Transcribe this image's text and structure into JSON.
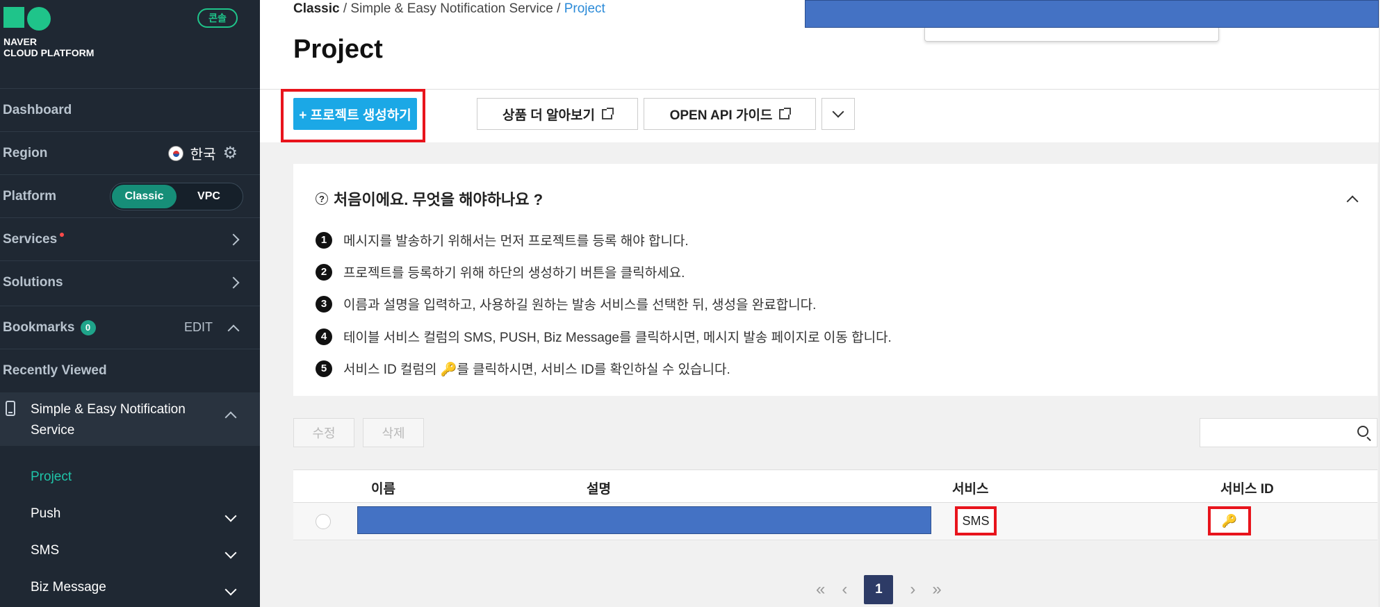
{
  "sidebar": {
    "logo_text_line1": "NAVER",
    "logo_text_line2": "CLOUD PLATFORM",
    "console_badge": "콘솔",
    "dashboard": "Dashboard",
    "region_label": "Region",
    "region_value": "한국",
    "platform_label": "Platform",
    "platform_options": [
      "Classic",
      "VPC"
    ],
    "services_label": "Services",
    "solutions_label": "Solutions",
    "bookmarks_label": "Bookmarks",
    "bookmarks_count": "0",
    "bookmarks_edit": "EDIT",
    "recently_viewed": "Recently Viewed",
    "service_title": "Simple & Easy Notification Service",
    "service_items": [
      "Project",
      "Push",
      "SMS",
      "Biz Message"
    ]
  },
  "breadcrumb": {
    "root": "Classic",
    "service": "Simple & Easy Notification Service",
    "current": "Project",
    "sep": "/"
  },
  "page_title": "Project",
  "toolbar": {
    "create_label": "+ 프로젝트 생성하기",
    "learn_more_label": "상품 더 알아보기",
    "api_guide_label": "OPEN API 가이드"
  },
  "guide": {
    "title": "처음이에요. 무엇을 해야하나요 ?",
    "steps": [
      {
        "num": "1",
        "text": "메시지를 발송하기 위해서는 먼저 프로젝트를 등록 해야 합니다."
      },
      {
        "num": "2",
        "text": "프로젝트를 등록하기 위해 하단의 생성하기 버튼을 클릭하세요."
      },
      {
        "num": "3",
        "text": "이름과 설명을 입력하고, 사용하길 원하는 발송 서비스를 선택한 뒤, 생성을 완료합니다."
      },
      {
        "num": "4",
        "text": "테이블 서비스 컬럼의 SMS, PUSH, Biz Message를 클릭하시면, 메시지 발송 페이지로 이동 합니다."
      },
      {
        "num": "5",
        "text_before": "서비스 ID 컬럼의 ",
        "text_after": "를 클릭하시면, 서비스 ID를 확인하실 수 있습니다."
      }
    ]
  },
  "actions": {
    "edit": "수정",
    "delete": "삭제"
  },
  "table": {
    "headers": {
      "name": "이름",
      "description": "설명",
      "service": "서비스",
      "service_id": "서비스 ID"
    },
    "rows": [
      {
        "service": "SMS"
      }
    ]
  },
  "pagination": {
    "current": "1",
    "first": "«",
    "prev": "‹",
    "next": "›",
    "last": "»"
  },
  "colors": {
    "accent": "#1ba8e6",
    "sidebar_bg": "#1f2833",
    "brand_green": "#1fc48a",
    "highlight_red": "#e8141c",
    "redaction_blue": "#4472c4"
  }
}
